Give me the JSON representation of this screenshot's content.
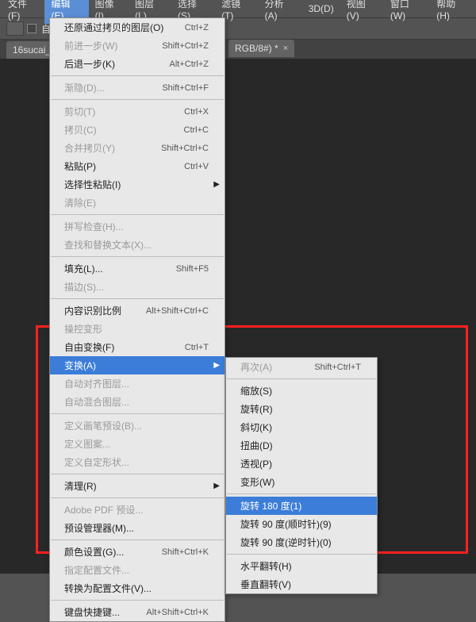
{
  "menubar": [
    "文件(F)",
    "编辑(E)",
    "图像(I)",
    "图层(L)",
    "选择(S)",
    "滤镜(T)",
    "分析(A)",
    "3D(D)",
    "视图(V)",
    "窗口(W)",
    "帮助(H)"
  ],
  "menubar_active": 1,
  "toolbar": {
    "checkbox_label": "自"
  },
  "tab": {
    "label": "16sucai_"
  },
  "tab2": {
    "label": "RGB/8#) *",
    "close": "×"
  },
  "edit_menu": [
    {
      "t": "item",
      "label": "还原通过拷贝的图层(O)",
      "shortcut": "Ctrl+Z"
    },
    {
      "t": "item",
      "label": "前进一步(W)",
      "shortcut": "Shift+Ctrl+Z",
      "disabled": true
    },
    {
      "t": "item",
      "label": "后退一步(K)",
      "shortcut": "Alt+Ctrl+Z"
    },
    {
      "t": "sep"
    },
    {
      "t": "item",
      "label": "渐隐(D)...",
      "shortcut": "Shift+Ctrl+F",
      "disabled": true
    },
    {
      "t": "sep"
    },
    {
      "t": "item",
      "label": "剪切(T)",
      "shortcut": "Ctrl+X",
      "disabled": true
    },
    {
      "t": "item",
      "label": "拷贝(C)",
      "shortcut": "Ctrl+C",
      "disabled": true
    },
    {
      "t": "item",
      "label": "合并拷贝(Y)",
      "shortcut": "Shift+Ctrl+C",
      "disabled": true
    },
    {
      "t": "item",
      "label": "粘贴(P)",
      "shortcut": "Ctrl+V"
    },
    {
      "t": "item",
      "label": "选择性粘贴(I)",
      "arrow": true
    },
    {
      "t": "item",
      "label": "清除(E)",
      "disabled": true
    },
    {
      "t": "sep"
    },
    {
      "t": "item",
      "label": "拼写检查(H)...",
      "disabled": true
    },
    {
      "t": "item",
      "label": "查找和替换文本(X)...",
      "disabled": true
    },
    {
      "t": "sep"
    },
    {
      "t": "item",
      "label": "填充(L)...",
      "shortcut": "Shift+F5"
    },
    {
      "t": "item",
      "label": "描边(S)...",
      "disabled": true
    },
    {
      "t": "sep"
    },
    {
      "t": "item",
      "label": "内容识别比例",
      "shortcut": "Alt+Shift+Ctrl+C"
    },
    {
      "t": "item",
      "label": "操控变形",
      "disabled": true
    },
    {
      "t": "item",
      "label": "自由变换(F)",
      "shortcut": "Ctrl+T"
    },
    {
      "t": "item",
      "label": "变换(A)",
      "arrow": true,
      "highlight": true
    },
    {
      "t": "item",
      "label": "自动对齐图层...",
      "disabled": true
    },
    {
      "t": "item",
      "label": "自动混合图层...",
      "disabled": true
    },
    {
      "t": "sep"
    },
    {
      "t": "item",
      "label": "定义画笔预设(B)...",
      "disabled": true
    },
    {
      "t": "item",
      "label": "定义图案...",
      "disabled": true
    },
    {
      "t": "item",
      "label": "定义自定形状...",
      "disabled": true
    },
    {
      "t": "sep"
    },
    {
      "t": "item",
      "label": "清理(R)",
      "arrow": true
    },
    {
      "t": "sep"
    },
    {
      "t": "item",
      "label": "Adobe PDF 预设...",
      "disabled": true
    },
    {
      "t": "item",
      "label": "预设管理器(M)..."
    },
    {
      "t": "sep"
    },
    {
      "t": "item",
      "label": "颜色设置(G)...",
      "shortcut": "Shift+Ctrl+K"
    },
    {
      "t": "item",
      "label": "指定配置文件...",
      "disabled": true
    },
    {
      "t": "item",
      "label": "转换为配置文件(V)..."
    },
    {
      "t": "sep"
    },
    {
      "t": "item",
      "label": "键盘快捷键...",
      "shortcut": "Alt+Shift+Ctrl+K"
    }
  ],
  "transform_submenu": [
    {
      "t": "item",
      "label": "再次(A)",
      "shortcut": "Shift+Ctrl+T",
      "disabled": true
    },
    {
      "t": "sep"
    },
    {
      "t": "item",
      "label": "缩放(S)"
    },
    {
      "t": "item",
      "label": "旋转(R)"
    },
    {
      "t": "item",
      "label": "斜切(K)"
    },
    {
      "t": "item",
      "label": "扭曲(D)"
    },
    {
      "t": "item",
      "label": "透视(P)"
    },
    {
      "t": "item",
      "label": "变形(W)"
    },
    {
      "t": "sep"
    },
    {
      "t": "item",
      "label": "旋转 180 度(1)",
      "highlight": true
    },
    {
      "t": "item",
      "label": "旋转 90 度(顺时针)(9)"
    },
    {
      "t": "item",
      "label": "旋转 90 度(逆时针)(0)"
    },
    {
      "t": "sep"
    },
    {
      "t": "item",
      "label": "水平翻转(H)"
    },
    {
      "t": "item",
      "label": "垂直翻转(V)"
    }
  ]
}
